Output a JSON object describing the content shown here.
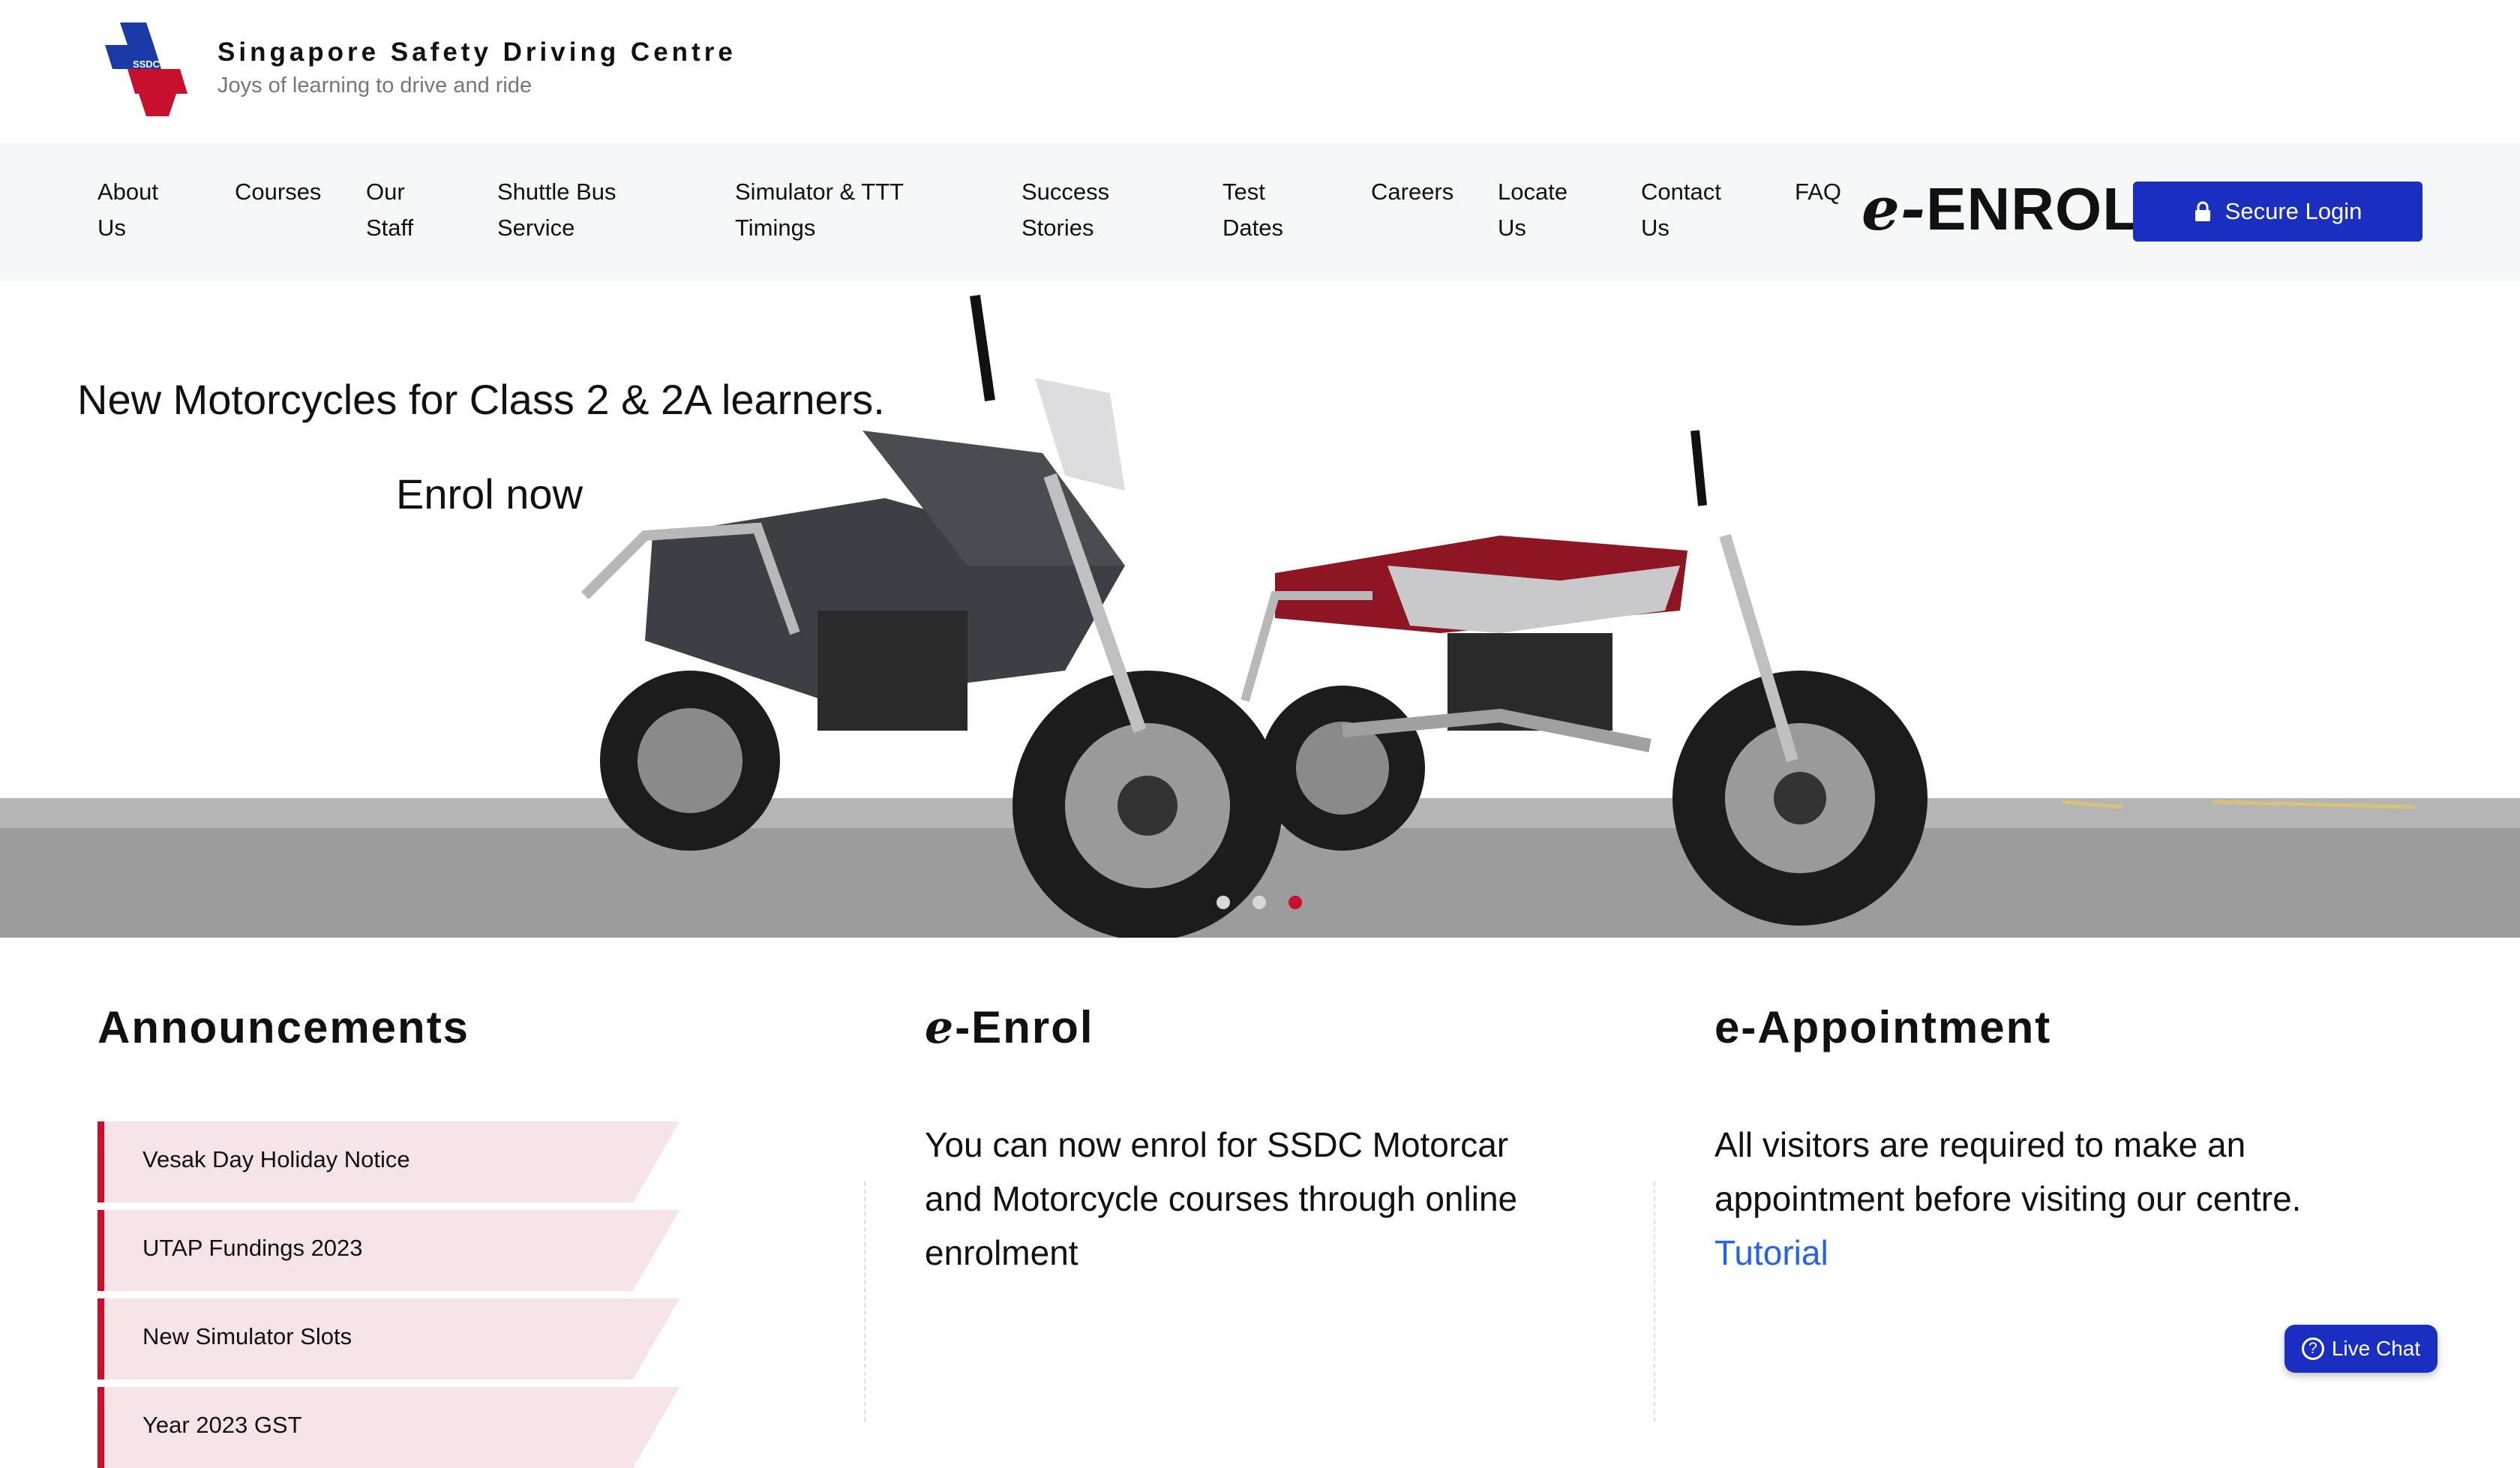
{
  "brand": {
    "title": "Singapore Safety Driving Centre",
    "tagline": "Joys of learning to drive and ride",
    "logo_text": "SSDC"
  },
  "nav": {
    "items": [
      {
        "label": "About Us"
      },
      {
        "label": "Courses"
      },
      {
        "label": "Our Staff"
      },
      {
        "label": "Shuttle Bus Service"
      },
      {
        "label": "Simulator & TTT Timings"
      },
      {
        "label": "Success Stories"
      },
      {
        "label": "Test Dates"
      },
      {
        "label": "Careers"
      },
      {
        "label": "Locate Us"
      },
      {
        "label": "Contact Us"
      },
      {
        "label": "FAQ"
      }
    ],
    "enrol_logo_prefix": "e-",
    "enrol_logo_word": "ENROL",
    "secure_login": "Secure Login",
    "secure_login_icon": "lock-icon"
  },
  "hero": {
    "headline": "New Motorcycles for Class 2 & 2A learners.",
    "subline": "Enrol now",
    "slides": 3,
    "active_slide": 3
  },
  "announcements": {
    "title": "Announcements",
    "items": [
      {
        "label": "Vesak Day Holiday Notice"
      },
      {
        "label": "UTAP Fundings 2023"
      },
      {
        "label": "New Simulator Slots"
      },
      {
        "label": "Year 2023 GST"
      }
    ]
  },
  "eenrol": {
    "title_prefix": "e",
    "title_rest": "-Enrol",
    "text": "You can now enrol for SSDC Motorcar and Motorcycle courses through online enrolment"
  },
  "eappointment": {
    "title": "e-Appointment",
    "text": "All visitors are required to make an appointment before visiting our centre.",
    "link": "Tutorial"
  },
  "live_chat": {
    "label": "Live Chat",
    "icon": "question-circle-icon"
  },
  "colors": {
    "accent_blue": "#1a2ec0",
    "accent_red": "#c8102e",
    "announcement_bg": "#f6e4e8",
    "link_blue": "#2463eb"
  }
}
